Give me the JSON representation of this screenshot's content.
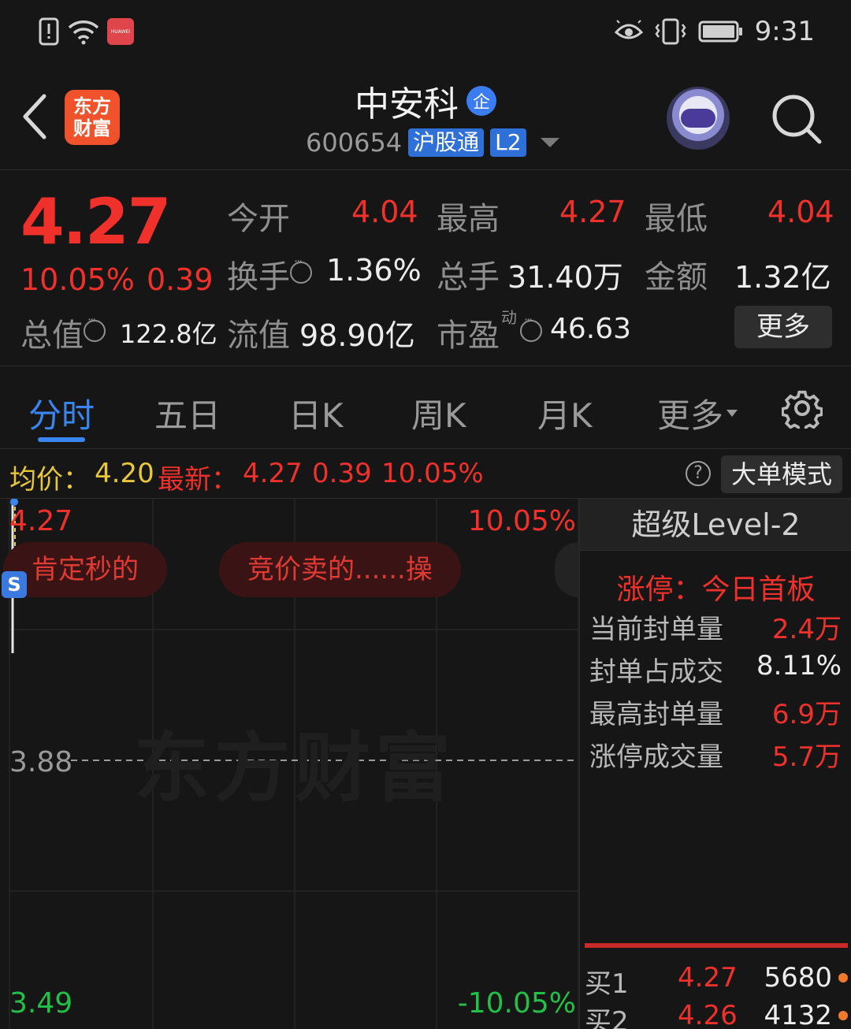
{
  "status_bar": {
    "time": "9:31",
    "left_icons": [
      "sim-alert-icon",
      "wifi-icon",
      "huawei-app-icon"
    ],
    "right_icons": [
      "eye-icon",
      "vibrate-icon",
      "battery-icon"
    ],
    "huawei_label": "HUAWEI"
  },
  "header": {
    "app_logo_text": "东方\n财富",
    "stock_name": "中安科",
    "enterprise_badge": "企",
    "stock_code": "600654",
    "tag_connect": "沪股通",
    "tag_level": "L2"
  },
  "quote": {
    "price": "4.27",
    "change_pct": "10.05%",
    "change_abs": "0.39",
    "labels": {
      "open": "今开",
      "high": "最高",
      "low": "最低",
      "turnover": "换手",
      "volume": "总手",
      "amount": "金额",
      "mkt_cap": "总值",
      "float_cap": "流值",
      "pe": "市盈",
      "pe_sup": "动"
    },
    "values": {
      "open": "4.04",
      "high": "4.27",
      "low": "4.04",
      "turnover": "1.36%",
      "volume": "31.40万",
      "amount": "1.32亿",
      "mkt_cap": "122.8亿",
      "float_cap": "98.90亿",
      "pe": "46.63"
    },
    "more_button": "更多"
  },
  "tabs": {
    "items": [
      "分时",
      "五日",
      "日K",
      "周K",
      "月K",
      "更多"
    ],
    "active": "分时"
  },
  "strip": {
    "avg_label": "均价：",
    "avg_value": "4.20",
    "latest_label": "最新：",
    "latest_price": "4.27",
    "latest_chg": "0.39",
    "latest_pct": "10.05%",
    "help": "?",
    "big_order_button": "大单模式"
  },
  "chart": {
    "price_top": "4.27",
    "price_mid": "3.88",
    "price_bot": "3.49",
    "pct_top": "10.05%",
    "pct_bot": "-10.05%",
    "watermark": "东方财富",
    "bubbles": [
      "肯定秒的",
      "竞价卖的......操"
    ],
    "marker": "S",
    "colors": {
      "up": "#f0302a",
      "down": "#22c048",
      "accent": "#3a86f0"
    }
  },
  "level2": {
    "header": "超级Level-2",
    "title": "涨停：今日首板",
    "rows": [
      {
        "label": "当前封单量",
        "value": "2.4万",
        "color": "#f0302a"
      },
      {
        "label": "封单占成交",
        "value": "8.11%",
        "color": "#ececec"
      },
      {
        "label": "最高封单量",
        "value": "6.9万",
        "color": "#f0302a"
      },
      {
        "label": "涨停成交量",
        "value": "5.7万",
        "color": "#f0302a"
      }
    ],
    "order_book": [
      {
        "side": "买1",
        "price": "4.27",
        "qty": "5680"
      },
      {
        "side": "买2",
        "price": "4.26",
        "qty": "4132"
      }
    ]
  }
}
